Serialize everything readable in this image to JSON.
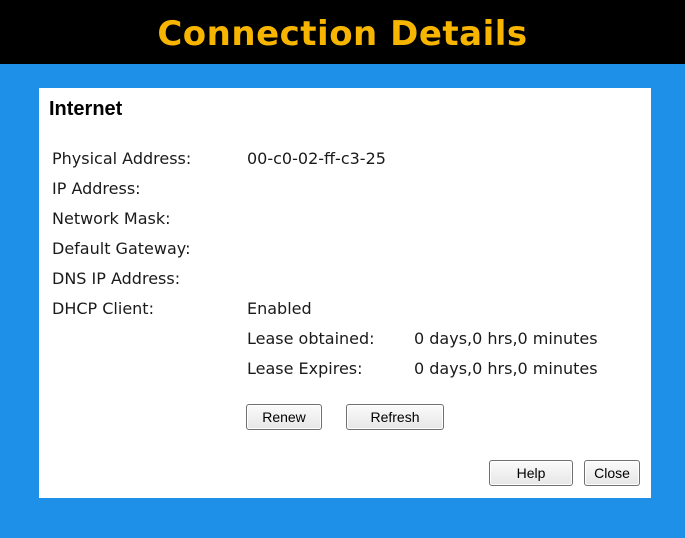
{
  "header": {
    "title": "Connection Details"
  },
  "section": {
    "title": "Internet"
  },
  "details": {
    "physical_address": {
      "label": "Physical Address:",
      "value": "00-c0-02-ff-c3-25"
    },
    "ip_address": {
      "label": "IP Address:",
      "value": ""
    },
    "network_mask": {
      "label": "Network Mask:",
      "value": ""
    },
    "default_gateway": {
      "label": "Default Gateway:",
      "value": ""
    },
    "dns_ip_address": {
      "label": "DNS IP Address:",
      "value": ""
    },
    "dhcp_client": {
      "label": "DHCP Client:",
      "value": "Enabled"
    },
    "lease_obtained": {
      "label": "Lease obtained:",
      "value": "0 days,0 hrs,0 minutes"
    },
    "lease_expires": {
      "label": "Lease Expires:",
      "value": "0 days,0 hrs,0 minutes"
    }
  },
  "buttons": {
    "renew": "Renew",
    "refresh": "Refresh",
    "help": "Help",
    "close": "Close"
  },
  "colors": {
    "frame_blue": "#1e90e8",
    "title_bar": "#000000",
    "title_text": "#f7b500",
    "panel": "#ffffff"
  }
}
